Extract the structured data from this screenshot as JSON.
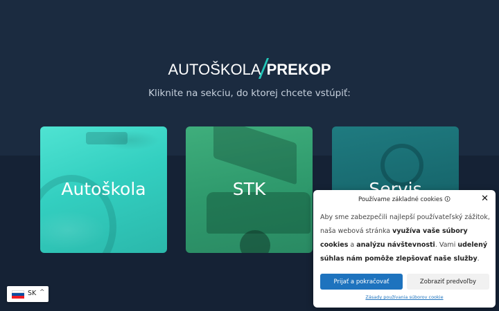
{
  "logo": {
    "part1": "AUTOŠKOLA",
    "part2": "PREKOP"
  },
  "subtitle": "Kliknite na sekciu, do ktorej chcete vstúpiť:",
  "sections": [
    {
      "label": "Autoškola",
      "color": "#3ed6c5"
    },
    {
      "label": "STK",
      "color": "#35a373"
    },
    {
      "label": "Servis",
      "color": "#1b6e74"
    }
  ],
  "cookie_banner": {
    "title": "Používame základné cookies 🛈",
    "text_1": "Aby sme zabezpečili najlepší používateľský zážitok, naša webová stránka ",
    "text_bold_1": "využíva vaše súbory cookies",
    "text_2": " a ",
    "text_bold_2": "analýzu návštevnosti",
    "text_3": ". Vami ",
    "text_bold_3": "udelený súhlas nám pomôže zlepšovať naše služby",
    "text_4": ".",
    "accept_label": "Prijať a pokračovať",
    "preferences_label": "Zobraziť predvoľby",
    "policy_link": "Zásady používania súborov cookie",
    "accent_color": "#1e73be"
  },
  "language_switcher": {
    "code": "SK",
    "flag": "slovakia-flag-icon"
  }
}
